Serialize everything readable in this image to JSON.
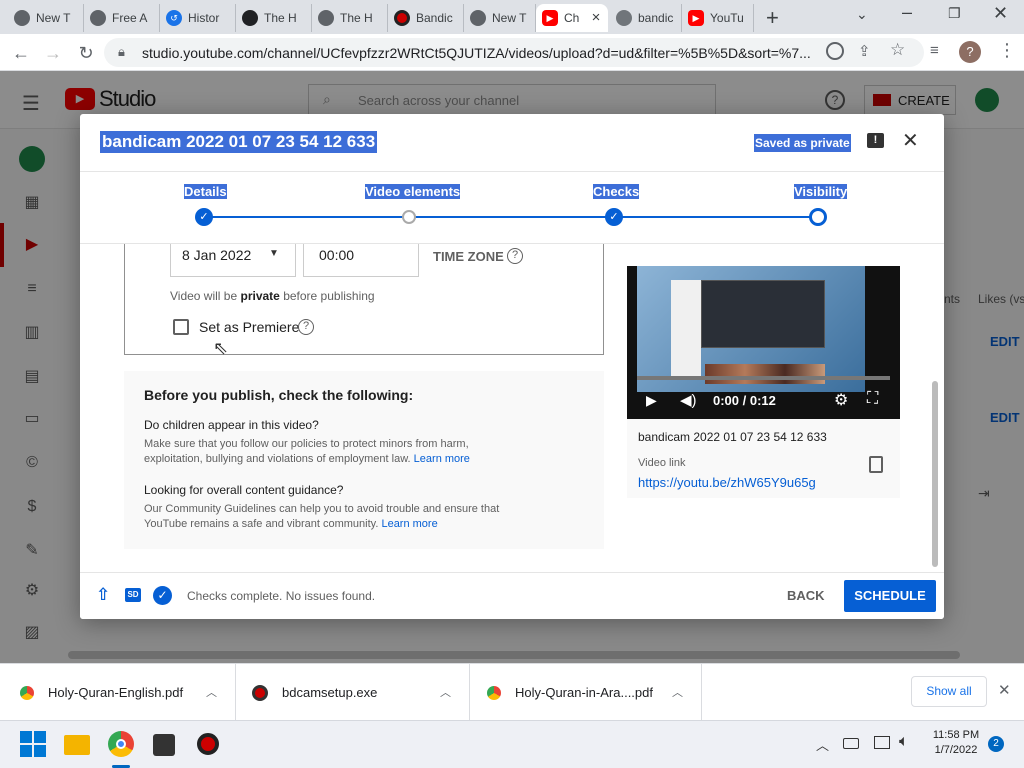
{
  "browser": {
    "tabs": [
      {
        "label": "New T",
        "icon": "chrome-icon"
      },
      {
        "label": "Free A",
        "icon": "chrome-icon"
      },
      {
        "label": "Histor",
        "icon": "history-icon"
      },
      {
        "label": "The H",
        "icon": "site-icon"
      },
      {
        "label": "The H",
        "icon": "chrome-icon"
      },
      {
        "label": "Bandic",
        "icon": "bandicam-icon"
      },
      {
        "label": "New T",
        "icon": "chrome-icon"
      },
      {
        "label": "Ch",
        "icon": "youtube-icon",
        "active": true
      },
      {
        "label": "bandic",
        "icon": "globe-icon"
      },
      {
        "label": "YouTu",
        "icon": "youtube-icon"
      }
    ],
    "url": "studio.youtube.com/channel/UCfevpfzzr2WRtCt5QJUTIZA/videos/upload?d=ud&filter=%5B%5D&sort=%7...",
    "profile_initial": "?"
  },
  "studio": {
    "logo_text": "Studio",
    "search_placeholder": "Search across your channel",
    "create_label": "CREATE",
    "bg_col_header": "Likes (vs.",
    "bg_col_header2": "nts",
    "edit_label_1": "EDIT D",
    "edit_label_2": "EDIT D"
  },
  "dialog": {
    "title": "bandicam 2022 01 07 23 54 12 633",
    "saved_status": "Saved as private",
    "steps": [
      {
        "label": "Details",
        "state": "done"
      },
      {
        "label": "Video elements",
        "state": "incomplete"
      },
      {
        "label": "Checks",
        "state": "done"
      },
      {
        "label": "Visibility",
        "state": "current"
      }
    ],
    "schedule": {
      "date": "8 Jan 2022",
      "time": "00:00",
      "timezone_label": "TIME ZONE",
      "note_pre": "Video will be ",
      "note_bold": "private",
      "note_post": " before publishing",
      "premiere_label": "Set as Premiere",
      "premiere_checked": false
    },
    "checklist": {
      "heading": "Before you publish, check the following:",
      "items": [
        {
          "title": "Do children appear in this video?",
          "body_1": "Make sure that you follow our policies to protect minors from harm,",
          "body_2": "exploitation, bullying and violations of employment law.",
          "link": "Learn more"
        },
        {
          "title": "Looking for overall content guidance?",
          "body_1": "Our Community Guidelines can help you to avoid trouble and ensure that",
          "body_2": "YouTube remains a safe and vibrant community.",
          "link": "Learn more"
        }
      ]
    },
    "preview": {
      "time": "0:00 / 0:12",
      "video_title": "bandicam 2022 01 07 23 54 12 633",
      "link_label": "Video link",
      "link_url": "https://youtu.be/zhW65Y9u65g"
    },
    "footer": {
      "status": "Checks complete. No issues found.",
      "back_label": "BACK",
      "schedule_label": "SCHEDULE"
    }
  },
  "downloads": {
    "items": [
      "Holy-Quran-English.pdf",
      "bdcamsetup.exe",
      "Holy-Quran-in-Ara....pdf"
    ],
    "show_all": "Show all"
  },
  "taskbar": {
    "time": "11:58 PM",
    "date": "1/7/2022",
    "notification_count": "2"
  },
  "colors": {
    "accent": "#065fd4",
    "youtube_red": "#ff0000",
    "selection": "#3d6ed8"
  }
}
